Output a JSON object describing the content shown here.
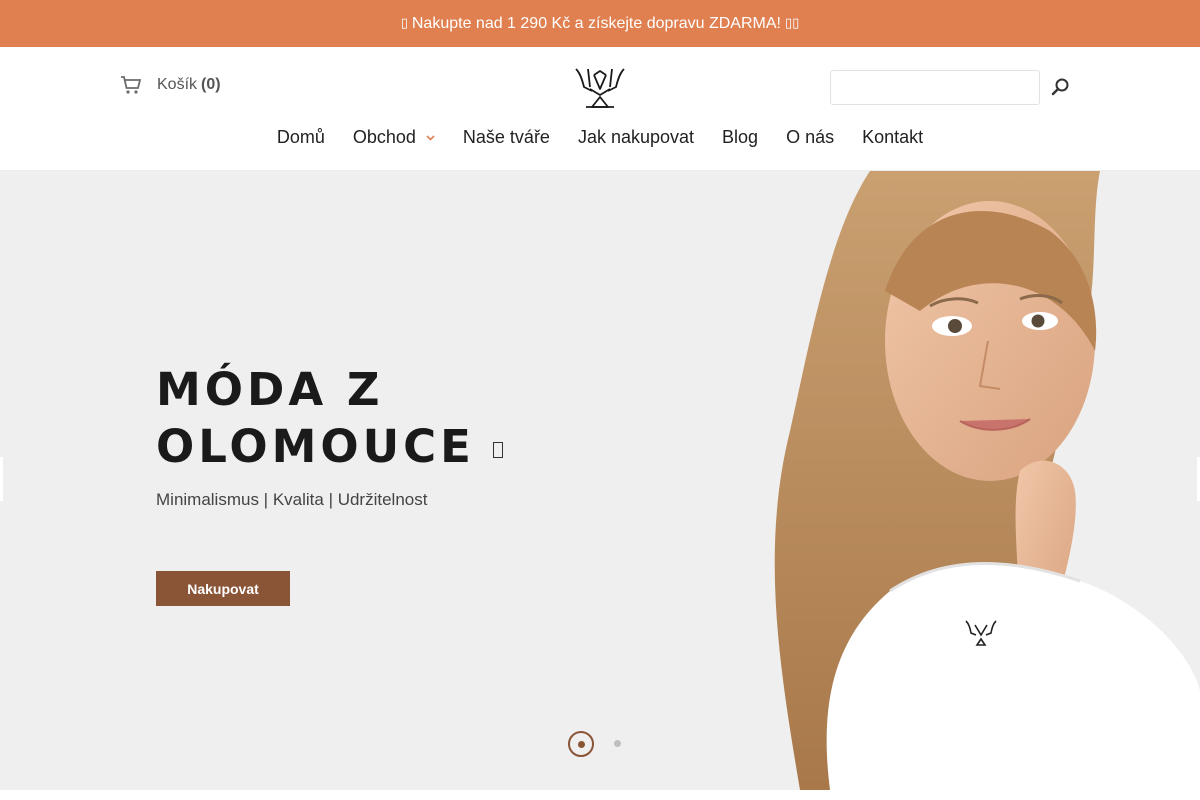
{
  "promo": {
    "lead_glyph": "▯",
    "text": "Nakupte nad 1 290 Kč a získejte dopravu ZDARMA!",
    "trail_glyph": "▯▯"
  },
  "header": {
    "cart_label": "Košík",
    "cart_count": "(0)",
    "search_value": ""
  },
  "nav": {
    "items": [
      "Domů",
      "Obchod",
      "Naše tváře",
      "Jak nakupovat",
      "Blog",
      "O nás",
      "Kontakt"
    ],
    "caret": "›"
  },
  "hero": {
    "headline_line1": "MÓDA Z",
    "headline_line2": "OLOMOUCE",
    "subtitle": "Minimalismus | Kvalita | Udržitelnost",
    "cta_label": "Nakupovat"
  },
  "colors": {
    "promo_bar": "#e08051",
    "accent_brown": "#8a5437",
    "hero_bg": "#efefef"
  },
  "icons": [
    "cart-icon",
    "brand-logo",
    "search-icon",
    "chevron-down-icon"
  ]
}
